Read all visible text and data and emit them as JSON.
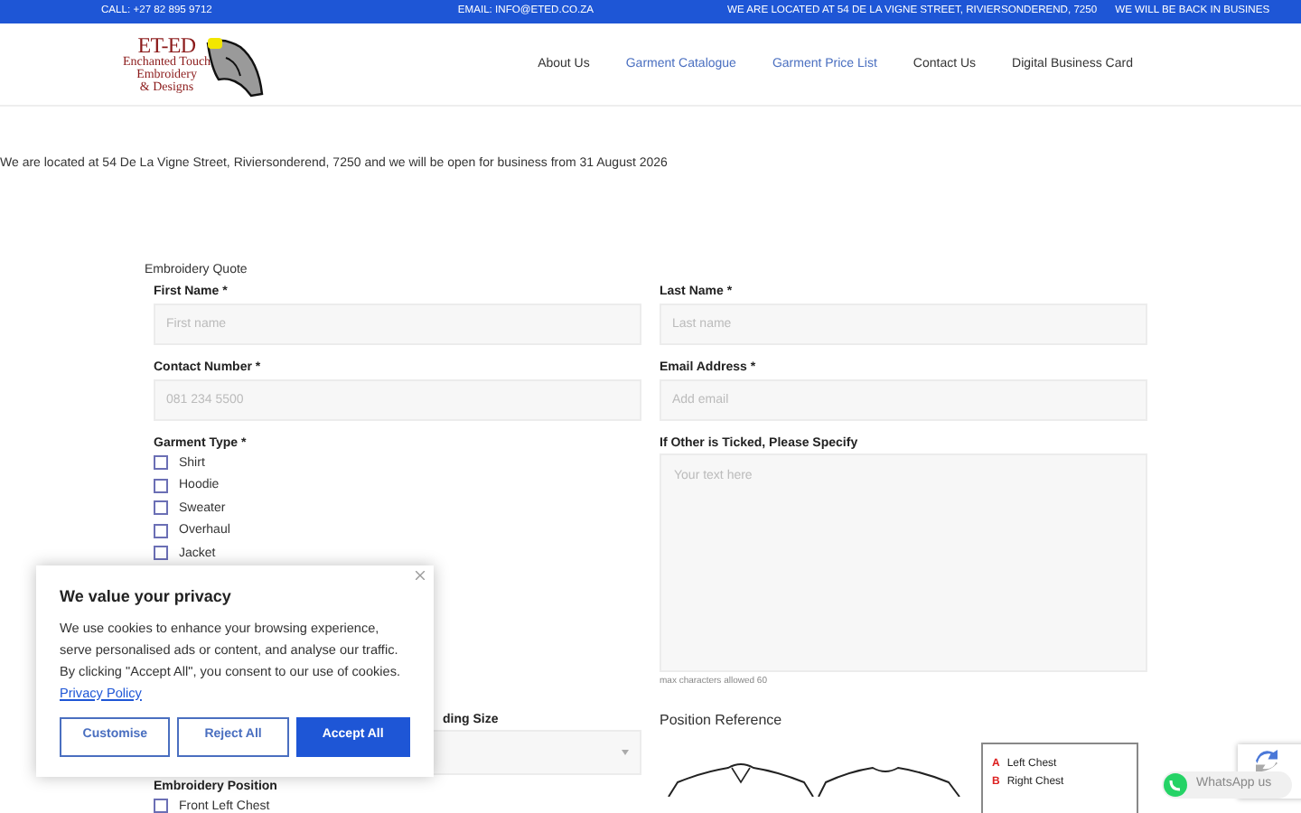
{
  "top_bar": {
    "items": [
      "CALL: +27 82 895 9712",
      "EMAIL: INFO@ETED.CO.ZA",
      "WE ARE LOCATED AT 54 DE LA VIGNE STREET, RIVIERSONDEREND, 7250",
      "WE WILL BE BACK IN BUSINES"
    ]
  },
  "logo": {
    "title": "ET-ED",
    "subtitle": [
      "Enchanted Touch",
      "Embroidery",
      "& Designs"
    ]
  },
  "nav": [
    {
      "label": "About Us",
      "highlighted": false
    },
    {
      "label": "Garment Catalogue",
      "highlighted": true
    },
    {
      "label": "Garment Price List",
      "highlighted": true
    },
    {
      "label": "Contact Us",
      "highlighted": false
    },
    {
      "label": "Digital Business Card",
      "highlighted": false
    }
  ],
  "notice": "We are located at 54 De La Vigne Street, Riviersonderend, 7250 and we will be open for business from 31 August 2026",
  "form": {
    "title": "Embroidery Quote",
    "fields": [
      {
        "label": "First Name *",
        "placeholder": "First name"
      },
      {
        "label": "Last Name *",
        "placeholder": "Last name"
      },
      {
        "label": "Contact Number *",
        "placeholder": "081 234 5500"
      },
      {
        "label": "Email Address *",
        "placeholder": "Add email"
      }
    ],
    "garment_type": {
      "label": "Garment Type *",
      "options": [
        {
          "label": "Shirt",
          "checked": false
        },
        {
          "label": "Hoodie",
          "checked": false
        },
        {
          "label": "Sweater",
          "checked": false
        },
        {
          "label": "Overhaul",
          "checked": false
        },
        {
          "label": "Jacket",
          "checked": false
        }
      ]
    },
    "other": {
      "label": "If Other is Ticked, Please Specify",
      "placeholder": "Your text here",
      "hint": "max characters allowed 60"
    },
    "size": {
      "label": "ding Size"
    },
    "position": {
      "label": "Embroidery Position",
      "options": [
        {
          "label": "Front Left Chest",
          "checked": false
        }
      ]
    },
    "reference": {
      "title": "Position Reference",
      "legend": [
        {
          "letter": "A",
          "label": "Left Chest"
        },
        {
          "letter": "B",
          "label": "Right Chest"
        }
      ]
    }
  },
  "cookie": {
    "title": "We value your privacy",
    "body": "We use cookies to enhance your browsing experience, serve personalised ads or content, and analyse our traffic. By clicking \"Accept All\", you consent to our use of",
    "link_prefix": "cookies.",
    "link": "Privacy Policy",
    "buttons": [
      {
        "label": "Customise",
        "kind": "outline"
      },
      {
        "label": "Reject All",
        "kind": "outline"
      },
      {
        "label": "Accept All",
        "kind": "primary"
      }
    ]
  },
  "whatsapp": {
    "label": "WhatsApp us"
  }
}
